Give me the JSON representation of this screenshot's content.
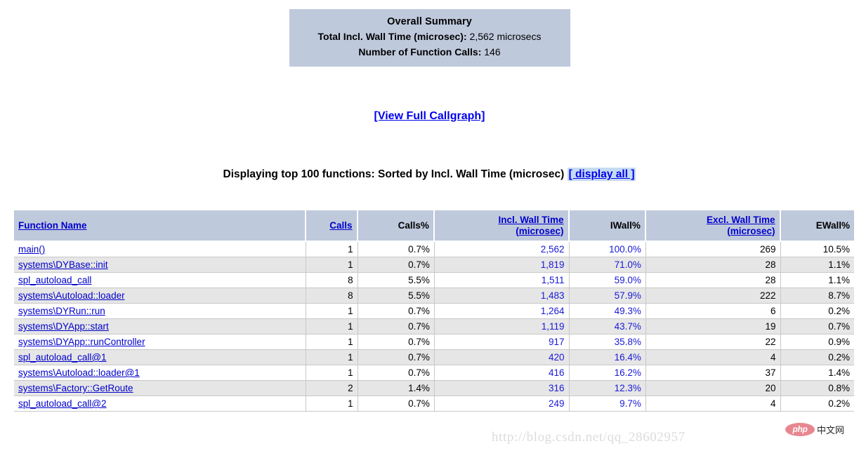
{
  "summary": {
    "title": "Overall Summary",
    "total_wall_label": "Total Incl. Wall Time (microsec):",
    "total_wall_value": "2,562 microsecs",
    "num_calls_label": "Number of Function Calls:",
    "num_calls_value": "146"
  },
  "callgraph_link": "[View Full Callgraph]",
  "display_heading": {
    "text": "Displaying top 100 functions: Sorted by Incl. Wall Time (microsec)",
    "display_all_link": "[ display all ]"
  },
  "table": {
    "headers": {
      "function_name": "Function Name",
      "calls": "Calls",
      "calls_pct": "Calls%",
      "incl_wall_time_l1": "Incl. Wall Time",
      "incl_wall_time_l2": "(microsec)",
      "iwall_pct": "IWall%",
      "excl_wall_time_l1": "Excl. Wall Time",
      "excl_wall_time_l2": "(microsec)",
      "ewall_pct": "EWall%"
    },
    "rows": [
      {
        "fn": "main()",
        "calls": "1",
        "calls_pct": "0.7%",
        "iwt": "2,562",
        "iwpct": "100.0%",
        "ewt": "269",
        "ewpct": "10.5%"
      },
      {
        "fn": "systems\\DYBase::init",
        "calls": "1",
        "calls_pct": "0.7%",
        "iwt": "1,819",
        "iwpct": "71.0%",
        "ewt": "28",
        "ewpct": "1.1%"
      },
      {
        "fn": "spl_autoload_call",
        "calls": "8",
        "calls_pct": "5.5%",
        "iwt": "1,511",
        "iwpct": "59.0%",
        "ewt": "28",
        "ewpct": "1.1%"
      },
      {
        "fn": "systems\\Autoload::loader",
        "calls": "8",
        "calls_pct": "5.5%",
        "iwt": "1,483",
        "iwpct": "57.9%",
        "ewt": "222",
        "ewpct": "8.7%"
      },
      {
        "fn": "systems\\DYRun::run",
        "calls": "1",
        "calls_pct": "0.7%",
        "iwt": "1,264",
        "iwpct": "49.3%",
        "ewt": "6",
        "ewpct": "0.2%"
      },
      {
        "fn": "systems\\DYApp::start",
        "calls": "1",
        "calls_pct": "0.7%",
        "iwt": "1,119",
        "iwpct": "43.7%",
        "ewt": "19",
        "ewpct": "0.7%"
      },
      {
        "fn": "systems\\DYApp::runController",
        "calls": "1",
        "calls_pct": "0.7%",
        "iwt": "917",
        "iwpct": "35.8%",
        "ewt": "22",
        "ewpct": "0.9%"
      },
      {
        "fn": "spl_autoload_call@1",
        "calls": "1",
        "calls_pct": "0.7%",
        "iwt": "420",
        "iwpct": "16.4%",
        "ewt": "4",
        "ewpct": "0.2%"
      },
      {
        "fn": "systems\\Autoload::loader@1",
        "calls": "1",
        "calls_pct": "0.7%",
        "iwt": "416",
        "iwpct": "16.2%",
        "ewt": "37",
        "ewpct": "1.4%"
      },
      {
        "fn": "systems\\Factory::GetRoute",
        "calls": "2",
        "calls_pct": "1.4%",
        "iwt": "316",
        "iwpct": "12.3%",
        "ewt": "20",
        "ewpct": "0.8%"
      },
      {
        "fn": "spl_autoload_call@2",
        "calls": "1",
        "calls_pct": "0.7%",
        "iwt": "249",
        "iwpct": "9.7%",
        "ewt": "4",
        "ewpct": "0.2%"
      }
    ]
  },
  "watermarks": {
    "url": "http://blog.csdn.net/qq_28602957",
    "php_badge": "php",
    "php_text": "中文网"
  },
  "colors": {
    "header_bg": "#bfc9dc",
    "link_blue": "#0000cc",
    "value_blue": "#1a1ad6",
    "row_alt_bg": "#e6e6e6",
    "highlight_bg": "#c5dbf2"
  }
}
